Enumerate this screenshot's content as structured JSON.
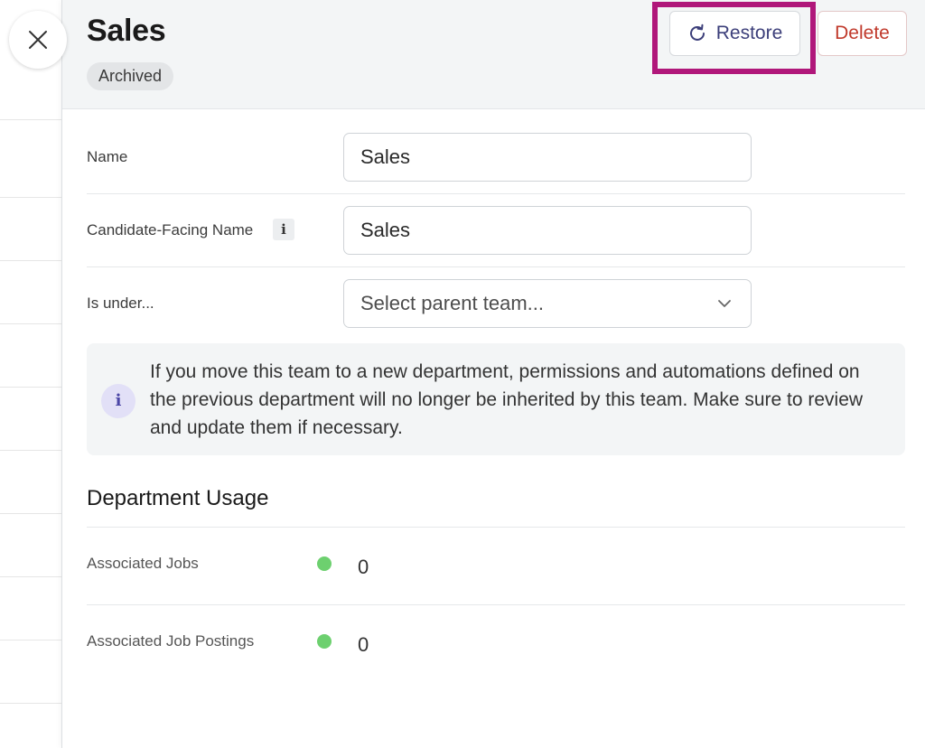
{
  "header": {
    "title": "Sales",
    "status_badge": "Archived",
    "restore_label": "Restore",
    "delete_label": "Delete"
  },
  "form": {
    "name_label": "Name",
    "name_value": "Sales",
    "candidate_label": "Candidate-Facing Name",
    "candidate_info": "i",
    "candidate_value": "Sales",
    "parent_label": "Is under...",
    "parent_placeholder": "Select parent team..."
  },
  "notice": {
    "icon": "i",
    "text": "If you move this team to a new department, permissions and automations defined on the previous department will no longer be inherited by this team. Make sure to review and update them if necessary."
  },
  "usage": {
    "title": "Department Usage",
    "items": [
      {
        "label": "Associated Jobs",
        "value": "0"
      },
      {
        "label": "Associated Job Postings",
        "value": "0"
      }
    ]
  },
  "colors": {
    "highlight": "#b0177a",
    "delete": "#c0392b",
    "restore": "#3c3f7a",
    "status_dot": "#6dd06f"
  },
  "icons": [
    "close-icon",
    "restore-icon",
    "info-icon",
    "chevron-down-icon"
  ]
}
